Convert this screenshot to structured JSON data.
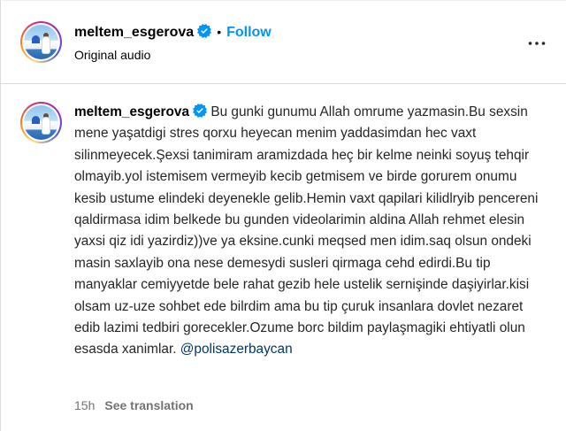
{
  "header": {
    "username": "meltem_esgerova",
    "separator": "•",
    "follow_label": "Follow",
    "audio_label": "Original audio"
  },
  "caption": {
    "username": "meltem_esgerova",
    "text": "Bu gunki gunumu Allah omrume yazmasin.Bu sexsin mene yaşatdigi stres qorxu heyecan menim yaddasimdan hec vaxt silinmeyecek.Şexsi tanimiram aramizdada heç bir kelme neinki soyuş tehqir olmayib.yol istemisem vermeyib kecib getmisem ve birde gorurem onumu kesib ustume elindeki deyenekle gelib.Hemin vaxt qapilari kilidlryib pencereni qaldirmasa idim belkede bu gunden videolarimin aldina Allah rehmet elesin yaxsi qiz idi yazirdiz))ve ya eksine.cunki meqsed men idim.saq olsun ondeki masin saxlayib ona nese demesydi susleri qirmaga cehd edirdi.Bu tip manyaklar cemiyyetde bele rahat gezib hele ustelik sernişinde daşiyirlar.kisi olsam uz-uze sohbet ede bilrdim ama bu tip çuruk insanlara dovlet nezaret edib lazimi tedbiri gorecekler.Ozume borc bildim paylaşmagiki ehtiyatli olun esasda xanimlar.",
    "mention": "@polisazerbaycan",
    "time": "15h",
    "see_translation_label": "See translation"
  },
  "colors": {
    "follow_blue": "#0095f6",
    "mention_blue": "#00376b",
    "verified_blue": "#0095f6",
    "meta_gray": "#737373"
  },
  "icons": {
    "verified": "verified-badge-icon",
    "more": "more-horizontal-icon"
  }
}
